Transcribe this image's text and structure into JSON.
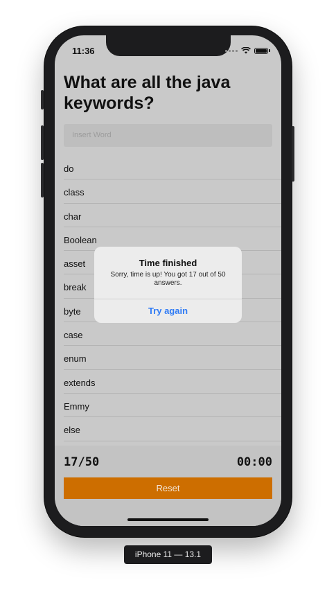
{
  "status": {
    "time": "11:36"
  },
  "page": {
    "title": "What are all the java keywords?"
  },
  "input": {
    "placeholder": "Insert Word"
  },
  "words": [
    "do",
    "class",
    "char",
    "Boolean",
    "asset",
    "break",
    "byte",
    "case",
    "enum",
    "extends",
    "Emmy",
    "else"
  ],
  "footer": {
    "score": "17/50",
    "timer": "00:00",
    "reset_label": "Reset"
  },
  "alert": {
    "title": "Time finished",
    "message": "Sorry, time is up! You got 17 out of 50 answers.",
    "button": "Try again"
  },
  "device_label": "iPhone 11 — 13.1",
  "colors": {
    "accent": "#cd6e00",
    "link": "#2f7bf5"
  },
  "icons": [
    "cellular-signal-icon",
    "wifi-icon",
    "battery-icon"
  ]
}
